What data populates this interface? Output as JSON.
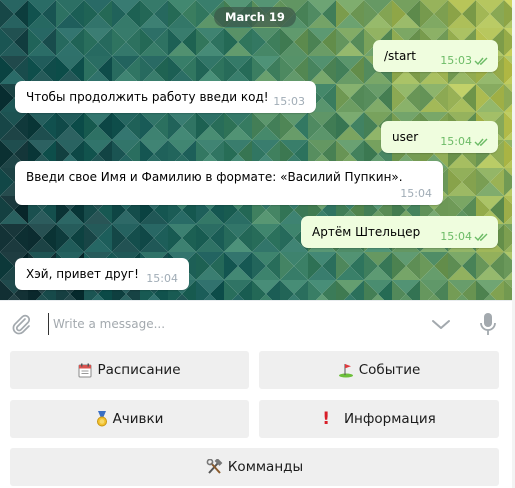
{
  "chat": {
    "date": "March 19",
    "messages": [
      {
        "dir": "out",
        "text": "/start",
        "time": "15:03",
        "read": true
      },
      {
        "dir": "in",
        "text": "Чтобы продолжить работу введи код!",
        "time": "15:03"
      },
      {
        "dir": "out",
        "text": "user",
        "time": "15:04",
        "read": true
      },
      {
        "dir": "in",
        "text": "Введи свое Имя и Фамилию в формате: «Василий Пупкин».",
        "time": "15:04"
      },
      {
        "dir": "out",
        "text": "Артём Штельцер",
        "time": "15:04",
        "read": true
      },
      {
        "dir": "in",
        "text": "Хэй, привет друг!",
        "time": "15:04"
      }
    ]
  },
  "composer": {
    "placeholder": "Write a message...",
    "attach_icon": "paperclip-icon",
    "emoji_icon": "chevron-down-icon",
    "mic_icon": "microphone-icon"
  },
  "keyboard": {
    "schedule": {
      "emoji": "calendar-icon",
      "label": "Расписание"
    },
    "event": {
      "emoji": "golf-flag-icon",
      "label": "Событие"
    },
    "achievements": {
      "emoji": "medal-icon",
      "label": "Ачивки"
    },
    "info": {
      "emoji": "exclamation-icon",
      "label": "Информация"
    },
    "commands": {
      "emoji": "hammer-wrench-icon",
      "label": "Комманды"
    }
  },
  "colors": {
    "incoming_bubble": "#ffffff",
    "outgoing_bubble": "#effdde",
    "read_ticks": "#6cbb66",
    "keyboard_button": "#efefef"
  }
}
